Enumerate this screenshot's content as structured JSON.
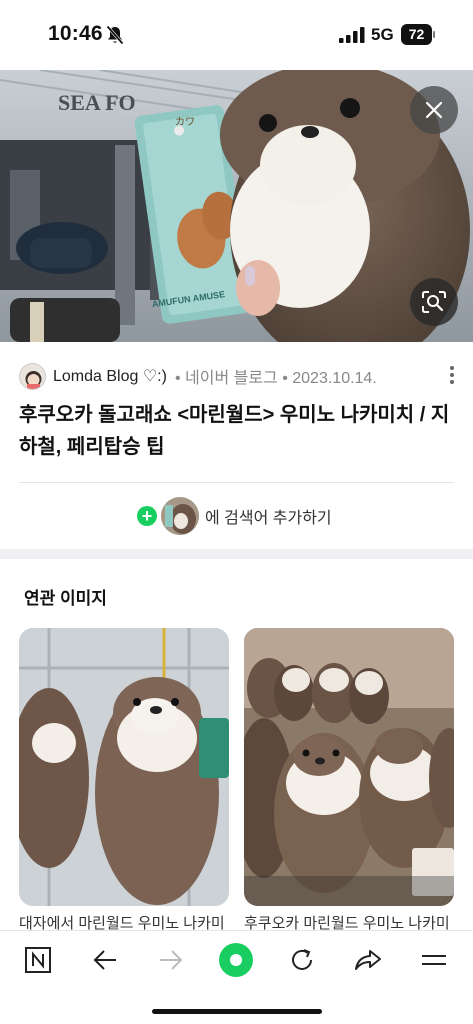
{
  "status_bar": {
    "time": "10:46",
    "network": "5G",
    "battery": "72"
  },
  "hero": {
    "sign_text": "SEA FO",
    "tag_text_1": "カワ",
    "tag_text_2": "AMUFUN AMUSE"
  },
  "result": {
    "source_name": "Lomda Blog ♡:)",
    "source_meta": "• 네이버 블로그 • 2023.10.14.",
    "title": "후쿠오카 돌고래쇼 <마린월드> 우미노 나카미치 / 지하철, 페리탑승 팁"
  },
  "add_search": {
    "label": "에 검색어 추가하기"
  },
  "related": {
    "section_title": "연관 이미지",
    "cards": [
      {
        "caption": "대자에서 마린월드 우미노 나카미"
      },
      {
        "caption": "후쿠오카 마린월드 우미노 나카미"
      }
    ]
  },
  "colors": {
    "accent_green": "#19ce60",
    "toolbar_icon": "#222222"
  },
  "icons": [
    "bell-slash-icon",
    "signal-icon",
    "close-icon",
    "image-search-icon",
    "more-vertical-icon",
    "naver-n-icon",
    "back-arrow-icon",
    "forward-arrow-icon",
    "green-home-icon",
    "refresh-icon",
    "share-icon",
    "menu-icon"
  ]
}
